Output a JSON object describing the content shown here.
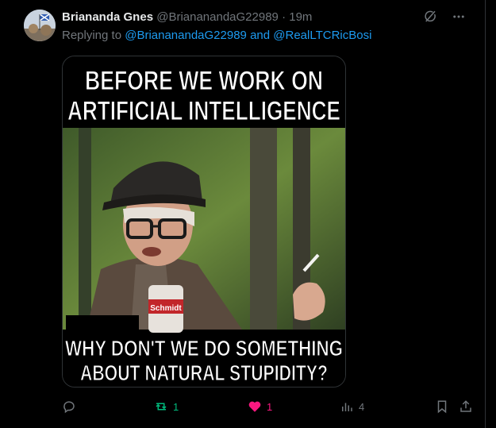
{
  "post": {
    "display_name": "Briananda Gnes",
    "handle": "@BriananandaG22989",
    "separator": "·",
    "time": "19m",
    "replying_prefix": "Replying to",
    "reply_user_1": "@BriananandaG22989",
    "reply_and": "and",
    "reply_user_2": "@RealLTCRicBosi"
  },
  "media": {
    "top_line_1": "BEFORE WE WORK ON",
    "top_line_2": "ARTIFICIAL INTELLIGENCE",
    "bottom_line_1": "WHY DON'T WE DO SOMETHING",
    "bottom_line_2": "ABOUT NATURAL STUPIDITY?",
    "can_label": "Schmidt"
  },
  "actions": {
    "replies": "",
    "reposts": "1",
    "likes": "1",
    "views": "4"
  },
  "colors": {
    "background": "#000000",
    "accent_link": "#1d9bf0",
    "repost_green": "#00ba7c",
    "like_pink": "#f91880",
    "muted": "#71767b"
  },
  "icons": [
    "grok-icon",
    "more-icon",
    "reply-icon",
    "repost-icon",
    "like-icon",
    "views-icon",
    "bookmark-icon",
    "share-icon"
  ]
}
